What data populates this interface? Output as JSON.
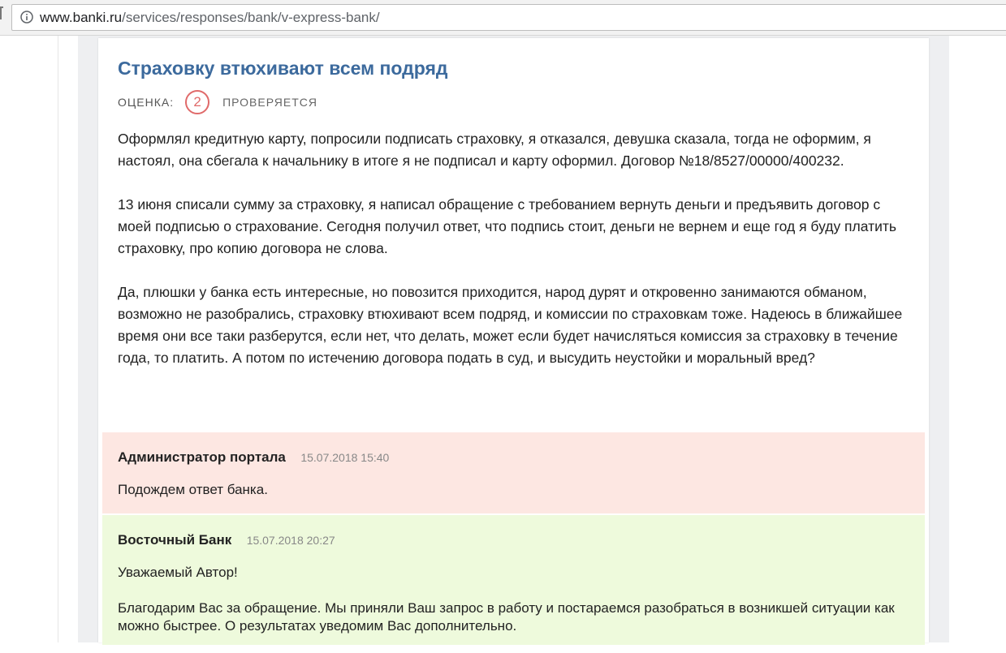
{
  "browser": {
    "url_host": "www.banki.ru",
    "url_path": "/services/responses/bank/v-express-bank/"
  },
  "review": {
    "title": "Страховку втюхивают всем подряд",
    "rating_label": "ОЦЕНКА:",
    "rating_value": "2",
    "status": "ПРОВЕРЯЕТСЯ",
    "paragraphs": [
      "Оформлял кредитную карту, попросили подписать страховку, я отказался, девушка сказала, тогда не оформим, я настоял, она сбегала к начальнику в итоге я не подписал и карту оформил. Договор №18/8527/00000/400232.",
      "13 июня списали сумму за страховку, я написал обращение с требованием вернуть деньги и предъявить договор с моей подписью о страхование. Сегодня получил ответ, что подпись стоит, деньги не вернем и еще год я буду платить страховку, про копию договора не слова.",
      "Да, плюшки у банка есть интересные, но повозится приходится, народ дурят и откровенно занимаются обманом, возможно не разобрались, страховку втюхивают всем подряд, и комиссии по страховкам тоже. Надеюсь в ближайшее время они все таки разберутся, если нет, что делать, может если будет начисляться комиссия за страховку в течение года, то платить. А потом по истечению договора подать в суд, и высудить неустойки и моральный вред?"
    ]
  },
  "comments": [
    {
      "author": "Администратор портала",
      "date": "15.07.2018 15:40",
      "paragraphs": [
        "Подождем ответ банка."
      ],
      "color": "#fde7e2"
    },
    {
      "author": "Восточный Банк",
      "date": "15.07.2018 20:27",
      "paragraphs": [
        "Уважаемый Автор!",
        "Благодарим Вас за обращение. Мы приняли Ваш запрос в работу и постараемся разобраться в возникшей ситуации как можно быстрее. О результатах уведомим Вас дополнительно."
      ],
      "color": "#eefadc"
    }
  ],
  "colors": {
    "title": "#3c6a9d",
    "rating": "#e06a6a"
  }
}
